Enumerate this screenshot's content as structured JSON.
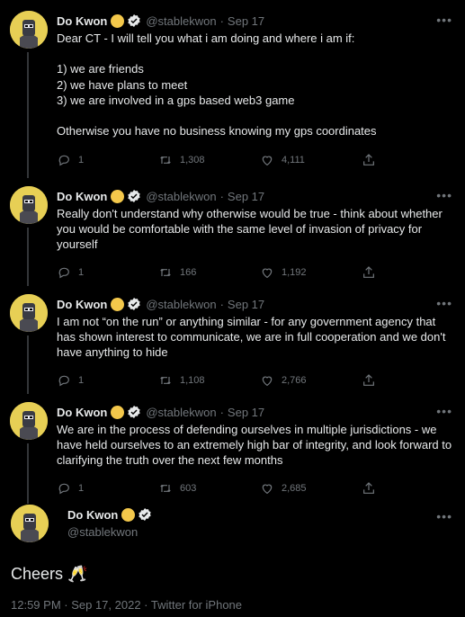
{
  "author": {
    "name": "Do Kwon",
    "handle": "@stablekwon",
    "avatar_color": "#e7cf55",
    "badge_color": "#f4c84b",
    "verified_color": "#e7e9ea"
  },
  "tweets": [
    {
      "date": "Sep 17",
      "text": "Dear CT - I will tell you what i am doing and where i am if:\n\n1) we are friends\n2) we have plans to meet\n3) we are involved in a gps based web3 game\n\nOtherwise you have no business knowing my gps coordinates",
      "replies": "1",
      "retweets": "1,308",
      "likes": "4,111"
    },
    {
      "date": "Sep 17",
      "text": "Really don't understand why otherwise would be true - think about whether you would be comfortable with the same level of invasion of privacy for yourself",
      "replies": "1",
      "retweets": "166",
      "likes": "1,192"
    },
    {
      "date": "Sep 17",
      "text": "I am not “on the run” or anything similar - for any government agency that has shown interest to communicate, we are in full cooperation and we don't have anything to hide",
      "replies": "1",
      "retweets": "1,108",
      "likes": "2,766"
    },
    {
      "date": "Sep 17",
      "text": "We are in the process of defending ourselves in multiple jurisdictions - we have held ourselves to an extremely high bar of integrity, and look forward to clarifying the truth over the next few months",
      "replies": "1",
      "retweets": "603",
      "likes": "2,685"
    }
  ],
  "main": {
    "text": "Cheers 🥂",
    "timestamp": "12:59 PM · Sep 17, 2022 · Twitter for iPhone"
  },
  "icons": {
    "more": "more-options-icon",
    "reply": "reply-icon",
    "retweet": "retweet-icon",
    "like": "heart-icon",
    "share": "share-icon"
  }
}
